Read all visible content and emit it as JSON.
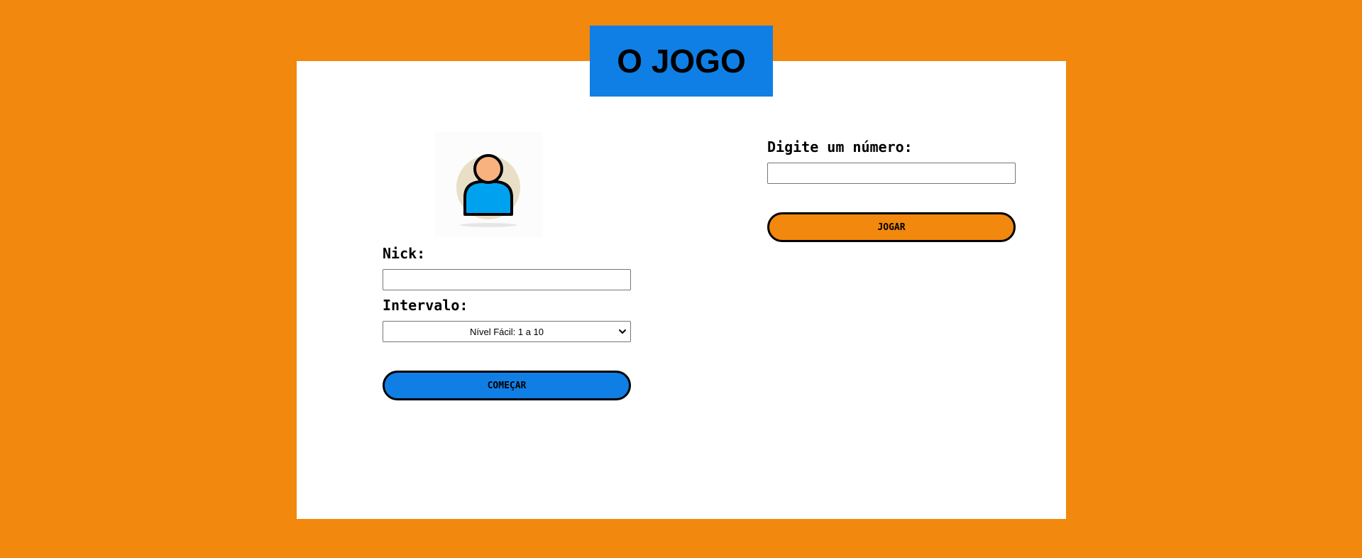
{
  "header": {
    "title": "O JOGO"
  },
  "login": {
    "avatar_icon": "user-avatar-icon",
    "nick_label": "Nick:",
    "nick_value": "",
    "interval_label": "Intervalo:",
    "interval_selected": "Nível Fácil: 1 a 10",
    "start_button": "COMEÇAR"
  },
  "game": {
    "number_label": "Digite um número:",
    "number_value": "",
    "play_button": "JOGAR"
  },
  "colors": {
    "background": "#F2880D",
    "title_box": "#0F7FE6",
    "start_button": "#0F7FE6",
    "play_button": "#F2880D",
    "avatar_body": "#00A2F0",
    "avatar_skin": "#F7B27F",
    "avatar_circle": "#E8DFC6"
  }
}
